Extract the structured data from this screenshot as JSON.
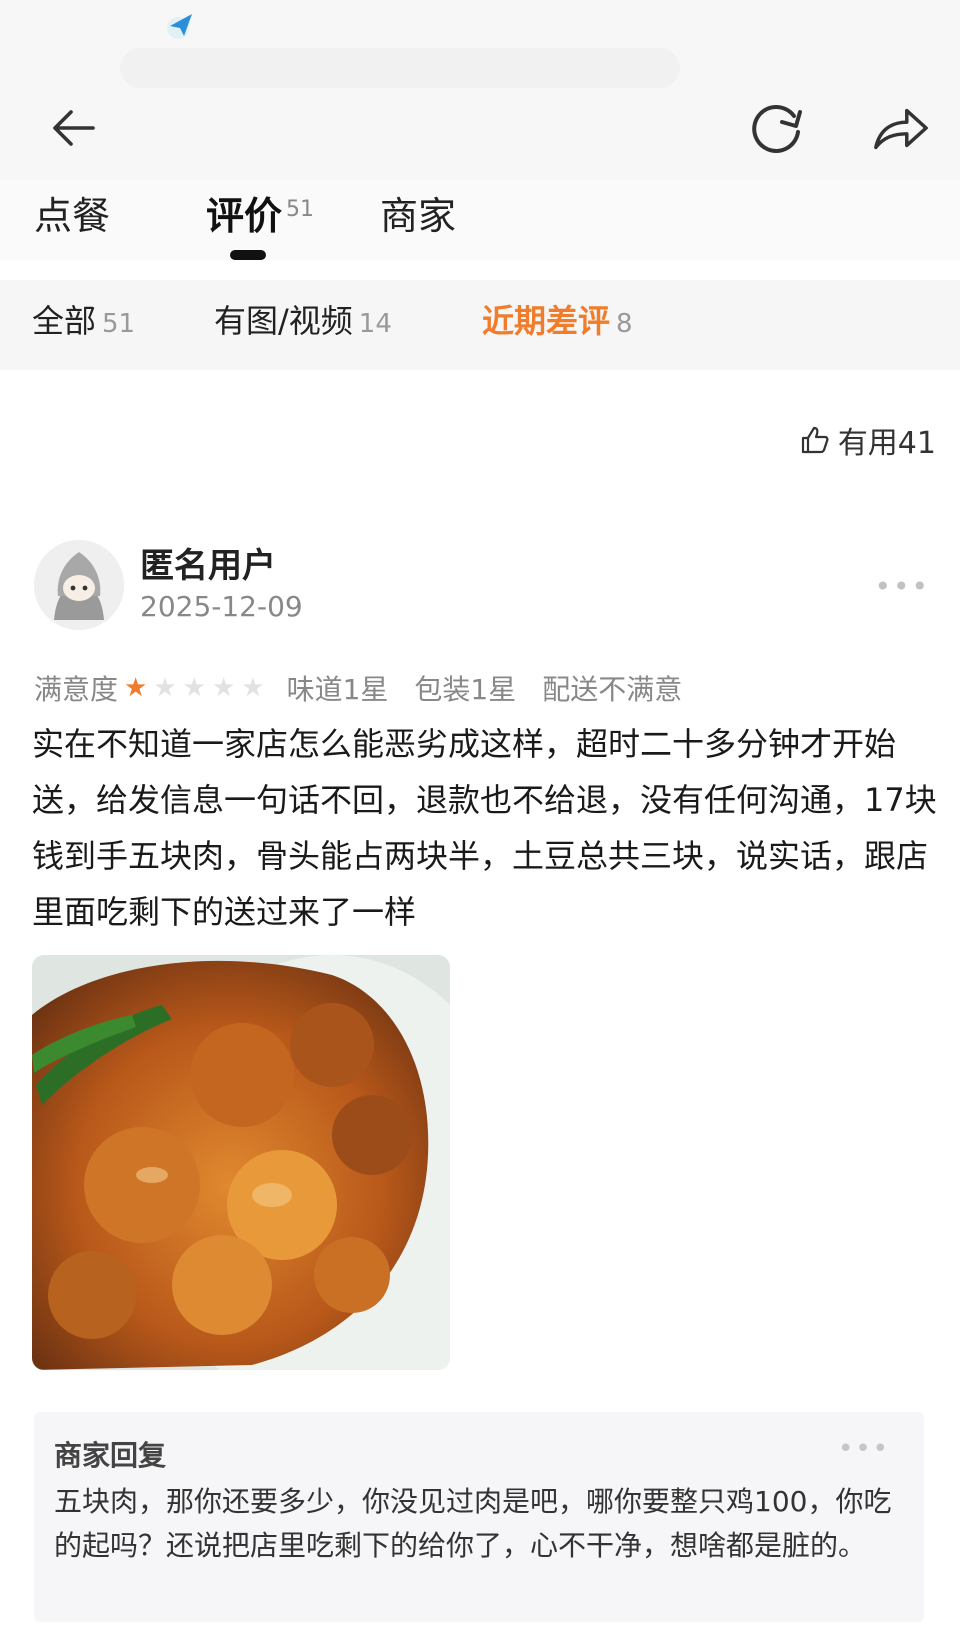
{
  "nav": {
    "back_icon": "back-arrow-icon",
    "refresh_icon": "refresh-icon",
    "share_icon": "share-icon"
  },
  "tabs": [
    {
      "label": "点餐",
      "count": ""
    },
    {
      "label": "评价",
      "count": "51"
    },
    {
      "label": "商家",
      "count": ""
    }
  ],
  "filters": [
    {
      "label": "全部",
      "count": "51"
    },
    {
      "label": "有图/视频",
      "count": "14"
    },
    {
      "label": "近期差评",
      "count": "8"
    }
  ],
  "colors": {
    "accent": "#f07d2b",
    "star_on": "#f07d2b",
    "star_off": "#e2e2e2"
  },
  "useful": {
    "label": "有用41",
    "icon": "thumbs-up-icon"
  },
  "review": {
    "user": "匿名用户",
    "date": "2025-12-09",
    "satisfaction_label": "满意度",
    "stars_filled": 1,
    "stars_total": 5,
    "taste": "味道1星",
    "packaging": "包装1星",
    "delivery": "配送不满意",
    "text": "实在不知道一家店怎么能恶劣成这样，超时二十多分钟才开始送，给发信息一句话不回，退款也不给退，没有任何沟通，17块钱到手五块肉，骨头能占两块半，土豆总共三块，说实话，跟店里面吃剩下的送过来了一样"
  },
  "merchant_reply": {
    "title": "商家回复",
    "text": "五块肉，那你还要多少，你没见过肉是吧，哪你要整只鸡100，你吃的起吗？还说把店里吃剩下的给你了，心不干净，想啥都是脏的。"
  }
}
